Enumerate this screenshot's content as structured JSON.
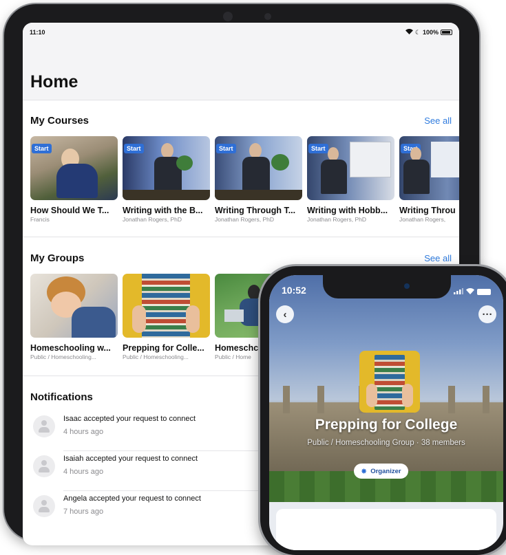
{
  "ipad": {
    "status": {
      "time": "11:10",
      "battery": "100%"
    },
    "title": "Home",
    "courses": {
      "title": "My Courses",
      "see_all": "See all",
      "items": [
        {
          "badge": "Start",
          "title": "How Should We T...",
          "author": "Francis"
        },
        {
          "badge": "Start",
          "title": "Writing with the B...",
          "author": "Jonathan Rogers, PhD"
        },
        {
          "badge": "Start",
          "title": "Writing Through T...",
          "author": "Jonathan Rogers, PhD"
        },
        {
          "badge": "Start",
          "title": "Writing with Hobb...",
          "author": "Jonathan Rogers, PhD"
        },
        {
          "badge": "Start",
          "title": "Writing Throu",
          "author": "Jonathan Rogers,"
        }
      ]
    },
    "groups": {
      "title": "My Groups",
      "see_all": "See all",
      "items": [
        {
          "title": "Homeschooling w...",
          "meta": "Public / Homeschooling..."
        },
        {
          "title": "Prepping for Colle...",
          "meta": "Public / Homeschooling..."
        },
        {
          "title": "Homeschc",
          "meta": "Public / Home"
        }
      ]
    },
    "notifications": {
      "title": "Notifications",
      "items": [
        {
          "text": "Isaac accepted your request to connect",
          "time": "4 hours ago"
        },
        {
          "text": "Isaiah accepted your request to connect",
          "time": "4 hours ago"
        },
        {
          "text": "Angela accepted your request to connect",
          "time": "7 hours ago"
        }
      ]
    }
  },
  "iphone": {
    "status": {
      "time": "10:52"
    },
    "back_icon": "chevron-left-icon",
    "more_icon": "ellipsis-icon",
    "group": {
      "title": "Prepping for College",
      "meta": "Public / Homeschooling Group · 38 members",
      "role": "Organizer"
    }
  },
  "colors": {
    "accent": "#2f7bde",
    "badge": "#2f6fd6",
    "text": "#111111",
    "muted": "#8a8a8e"
  }
}
